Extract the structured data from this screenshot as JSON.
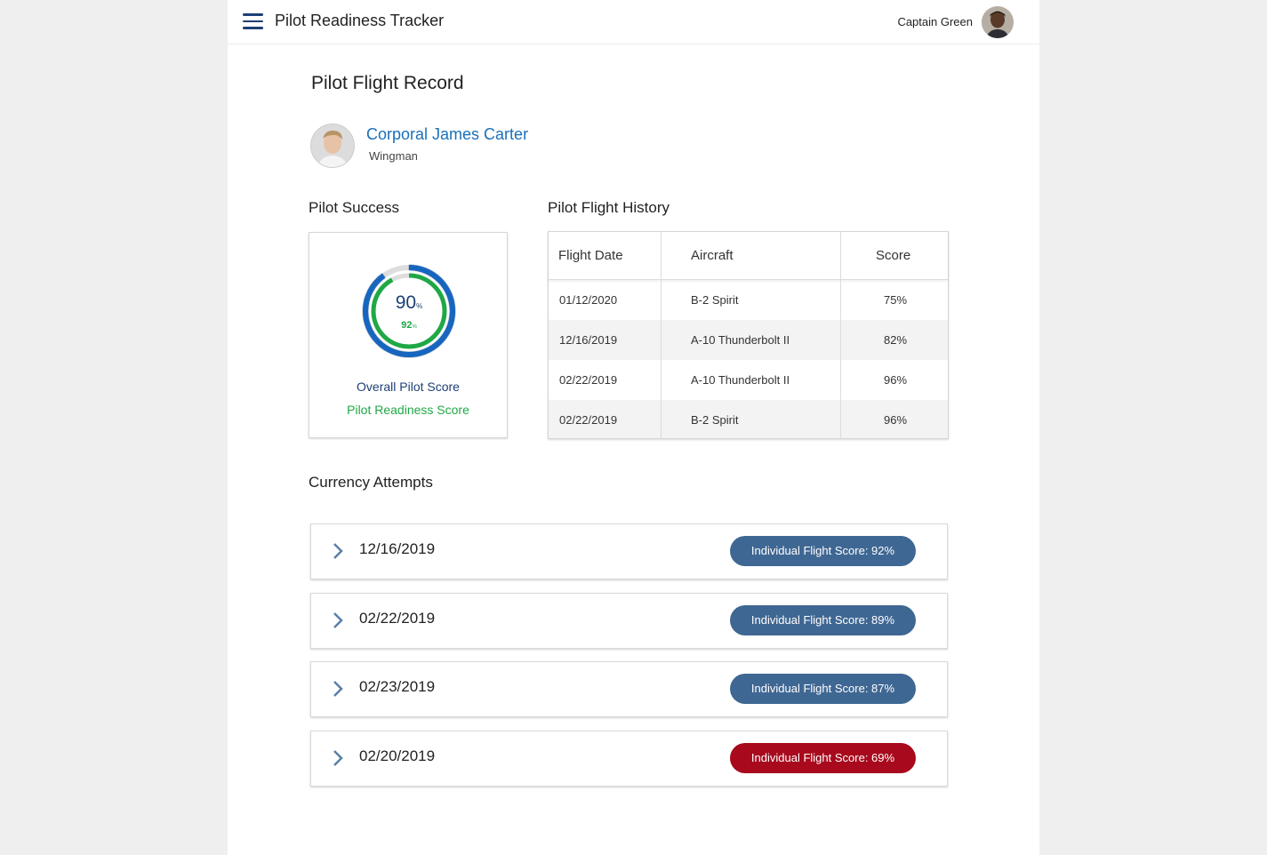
{
  "header": {
    "app_title": "Pilot Readiness Tracker",
    "user_name": "Captain Green"
  },
  "record": {
    "title": "Pilot Flight Record",
    "pilot_name": "Corporal James Carter",
    "pilot_role": "Wingman"
  },
  "success": {
    "title": "Pilot Success",
    "overall_value": "90",
    "overall_unit": "%",
    "readiness_value": "92",
    "readiness_unit": "%",
    "overall_label": "Overall Pilot Score",
    "readiness_label": "Pilot Readiness Score",
    "overall_fraction": 0.9,
    "readiness_fraction": 0.92,
    "colors": {
      "overall": "#1d3f74",
      "overall_ring": "#1666c0",
      "readiness": "#1fa845",
      "track": "#dddddd"
    }
  },
  "history": {
    "title": "Pilot Flight History",
    "columns": [
      "Flight Date",
      "Aircraft",
      "Score"
    ],
    "rows": [
      [
        "01/12/2020",
        "B-2 Spirit",
        "75%"
      ],
      [
        "12/16/2019",
        "A-10 Thunderbolt II",
        "82%"
      ],
      [
        "02/22/2019",
        "A-10 Thunderbolt II",
        "96%"
      ],
      [
        "02/22/2019",
        "B-2 Spirit",
        "96%"
      ]
    ]
  },
  "currency": {
    "title": "Currency Attempts",
    "attempts": [
      {
        "date": "12/16/2019",
        "score_label": "Individual Flight Score: 92%",
        "color": "#3f6793"
      },
      {
        "date": "02/22/2019",
        "score_label": "Individual Flight Score: 89%",
        "color": "#3f6793"
      },
      {
        "date": "02/23/2019",
        "score_label": "Individual Flight Score: 87%",
        "color": "#3f6793"
      },
      {
        "date": "02/20/2019",
        "score_label": "Individual Flight Score: 69%",
        "color": "#a8091c"
      }
    ]
  }
}
